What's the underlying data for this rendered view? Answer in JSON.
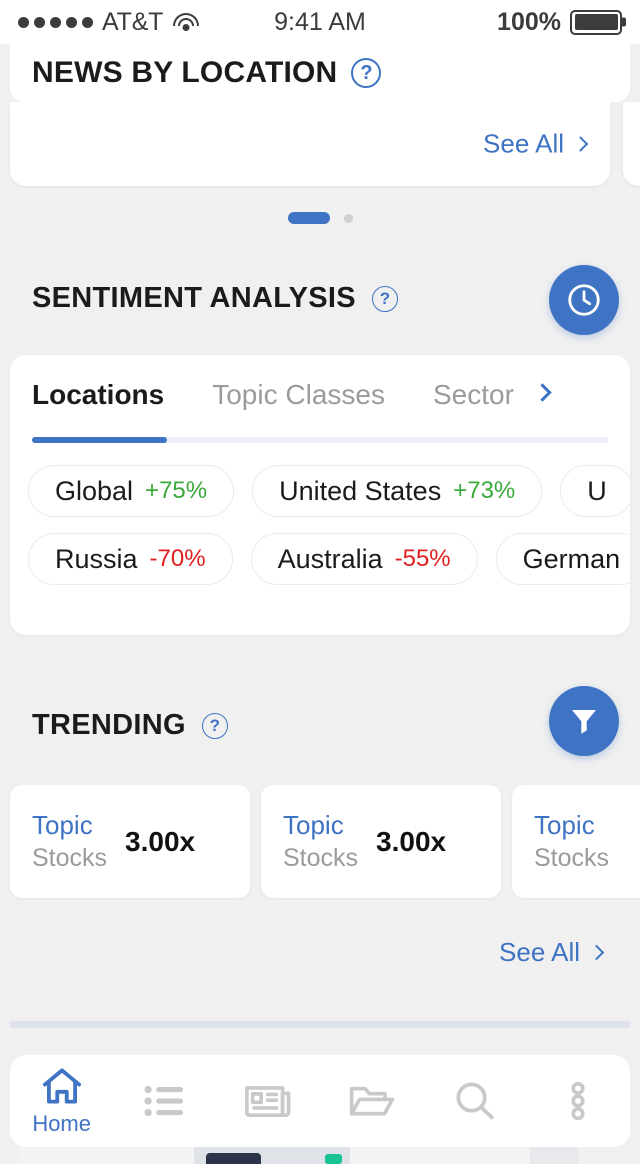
{
  "status_bar": {
    "signal_dots": 5,
    "carrier": "AT&T",
    "wifi_icon": "wifi-icon",
    "time": "9:41 AM",
    "battery_percent": "100%",
    "battery_icon": "battery-full-icon"
  },
  "header": {
    "title": "NEWS BY LOCATION",
    "help_icon": "question-mark-circle-icon"
  },
  "news_carousel": {
    "see_all_label": "See All",
    "chevron_icon": "chevron-right-icon",
    "page_count": 2,
    "active_page": 1
  },
  "sentiment": {
    "title": "SENTIMENT ANALYSIS",
    "help_icon": "question-mark-circle-icon",
    "fab_icon": "clock-icon",
    "tabs": [
      {
        "label": "Locations",
        "active": true
      },
      {
        "label": "Topic Classes",
        "active": false
      },
      {
        "label": "Sector",
        "active": false
      }
    ],
    "tabs_more_icon": "chevron-right-icon",
    "rows": [
      [
        {
          "name": "Global",
          "value": "+75%",
          "direction": "positive"
        },
        {
          "name": "United States",
          "value": "+73%",
          "direction": "positive"
        },
        {
          "name": "U",
          "value": "",
          "direction": "positive"
        }
      ],
      [
        {
          "name": "Russia",
          "value": "-70%",
          "direction": "negative"
        },
        {
          "name": "Australia",
          "value": "-55%",
          "direction": "negative"
        },
        {
          "name": "German",
          "value": "",
          "direction": "negative"
        }
      ]
    ]
  },
  "trending": {
    "title": "TRENDING",
    "help_icon": "question-mark-circle-icon",
    "fab_icon": "filter-funnel-icon",
    "cards": [
      {
        "topic": "Topic",
        "subtitle": "Stocks",
        "multiplier": "3.00x"
      },
      {
        "topic": "Topic",
        "subtitle": "Stocks",
        "multiplier": "3.00x"
      },
      {
        "topic": "Topic",
        "subtitle": "Stocks",
        "multiplier": ""
      }
    ],
    "see_all_label": "See All",
    "chevron_icon": "chevron-right-icon"
  },
  "bottom_nav": {
    "items": [
      {
        "label": "Home",
        "icon": "home-icon",
        "active": true
      },
      {
        "label": "",
        "icon": "list-icon",
        "active": false
      },
      {
        "label": "",
        "icon": "newspaper-icon",
        "active": false
      },
      {
        "label": "",
        "icon": "folder-open-icon",
        "active": false
      },
      {
        "label": "",
        "icon": "search-icon",
        "active": false
      },
      {
        "label": "",
        "icon": "more-vertical-icon",
        "active": false
      }
    ]
  },
  "colors": {
    "accent_blue": "#3f73c4",
    "positive_green": "#3aa93a",
    "negative_red": "#e02020",
    "muted_gray": "#9b9b9b",
    "page_background": "#f0f0f0"
  }
}
